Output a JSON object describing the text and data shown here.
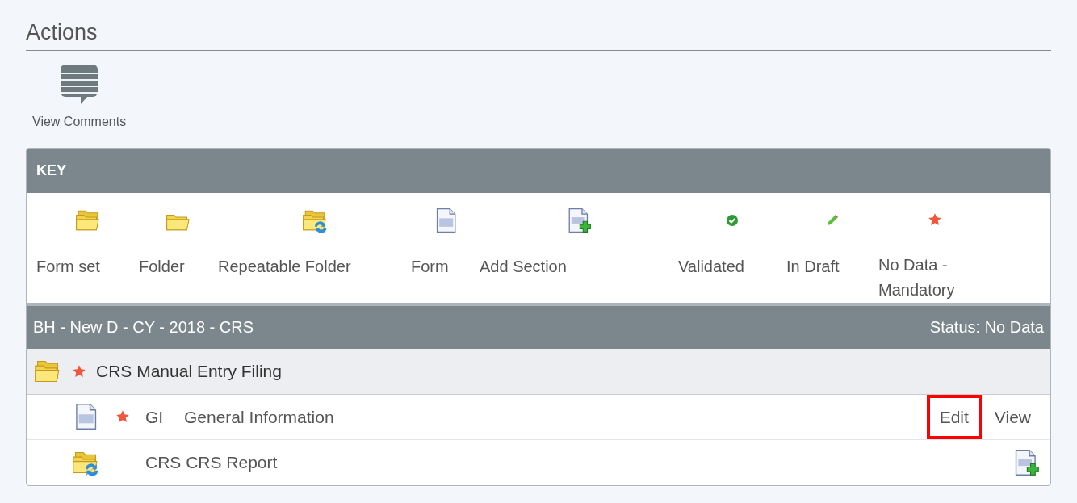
{
  "actions": {
    "title": "Actions",
    "items": [
      {
        "label": "View Comments",
        "kind": "comments"
      }
    ]
  },
  "key": {
    "title": "KEY",
    "items": [
      {
        "label": "Form set",
        "kind": "formset"
      },
      {
        "label": "Folder",
        "kind": "folder"
      },
      {
        "label": "Repeatable Folder",
        "kind": "repeatable"
      },
      {
        "label": "Form",
        "kind": "form"
      },
      {
        "label": "Add Section",
        "kind": "addsection"
      },
      {
        "label": "Validated",
        "kind": "validated"
      },
      {
        "label": "In Draft",
        "kind": "draft"
      },
      {
        "label": "No Data - Mandatory",
        "kind": "mandatory"
      }
    ]
  },
  "filing": {
    "title": "BH - New D - CY - 2018 - CRS",
    "status": "Status: No Data",
    "rows": [
      {
        "kind": "formset",
        "mandatory": true,
        "label": "CRS Manual Entry Filing"
      },
      {
        "kind": "form",
        "mandatory": true,
        "code": "GI",
        "label": "General Information",
        "links": [
          {
            "label": "Edit",
            "highlighted": true
          },
          {
            "label": "View",
            "highlighted": false
          }
        ]
      },
      {
        "kind": "repeatable",
        "mandatory": false,
        "label": "CRS CRS Report",
        "add_section": true
      }
    ]
  }
}
